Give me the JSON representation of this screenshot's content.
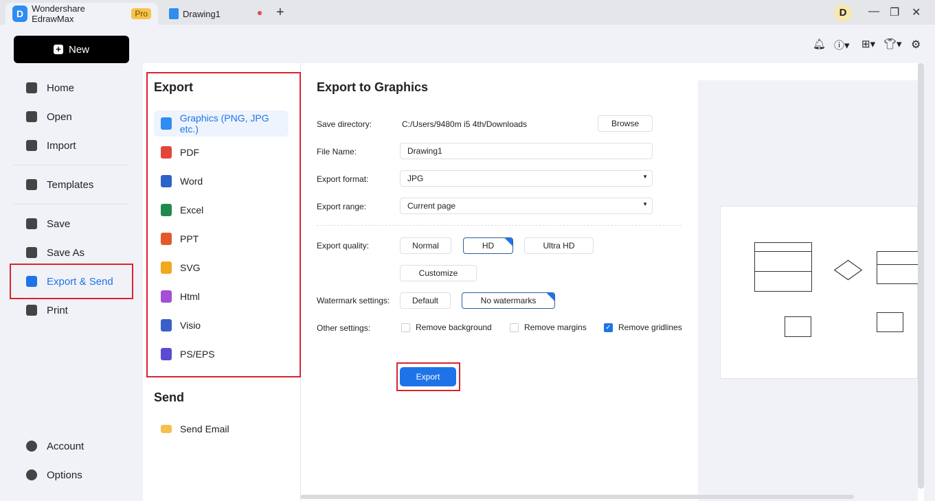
{
  "titlebar": {
    "app_tab": "Wondershare EdrawMax",
    "badge": "Pro",
    "doc_tab": "Drawing1",
    "avatar": "D"
  },
  "sidebar": {
    "new": "New",
    "items": [
      {
        "label": "Home"
      },
      {
        "label": "Open"
      },
      {
        "label": "Import"
      },
      {
        "label": "Templates"
      },
      {
        "label": "Save"
      },
      {
        "label": "Save As"
      },
      {
        "label": "Export & Send"
      },
      {
        "label": "Print"
      },
      {
        "label": "Account"
      },
      {
        "label": "Options"
      }
    ],
    "active": "Export & Send"
  },
  "export_list": {
    "heading": "Export",
    "items": [
      {
        "label": "Graphics (PNG, JPG etc.)",
        "color": "#2f8cf0"
      },
      {
        "label": "PDF",
        "color": "#e2463b"
      },
      {
        "label": "Word",
        "color": "#2b63c9"
      },
      {
        "label": "Excel",
        "color": "#1f8a4c"
      },
      {
        "label": "PPT",
        "color": "#e25a2b"
      },
      {
        "label": "SVG",
        "color": "#f0a920"
      },
      {
        "label": "Html",
        "color": "#a44fd6"
      },
      {
        "label": "Visio",
        "color": "#3a5fc8"
      },
      {
        "label": "PS/EPS",
        "color": "#5b4bd0"
      }
    ],
    "send_heading": "Send",
    "send_items": [
      {
        "label": "Send Email"
      }
    ]
  },
  "form": {
    "title": "Export to Graphics",
    "save_directory_label": "Save directory:",
    "save_directory": "C:/Users/9480m i5 4th/Downloads",
    "browse": "Browse",
    "file_name_label": "File Name:",
    "file_name": "Drawing1",
    "format_label": "Export format:",
    "format": "JPG",
    "range_label": "Export range:",
    "range": "Current page",
    "quality_label": "Export quality:",
    "quality_options": [
      "Normal",
      "HD",
      "Ultra HD"
    ],
    "quality_selected": "HD",
    "customize": "Customize",
    "watermark_label": "Watermark settings:",
    "watermark_options": [
      "Default",
      "No watermarks"
    ],
    "watermark_selected": "No watermarks",
    "other_label": "Other settings:",
    "other": [
      {
        "label": "Remove background",
        "checked": false
      },
      {
        "label": "Remove margins",
        "checked": false
      },
      {
        "label": "Remove gridlines",
        "checked": true
      }
    ],
    "export": "Export"
  },
  "colors": {
    "accent": "#1f73e8",
    "highlight": "#d9232d"
  }
}
